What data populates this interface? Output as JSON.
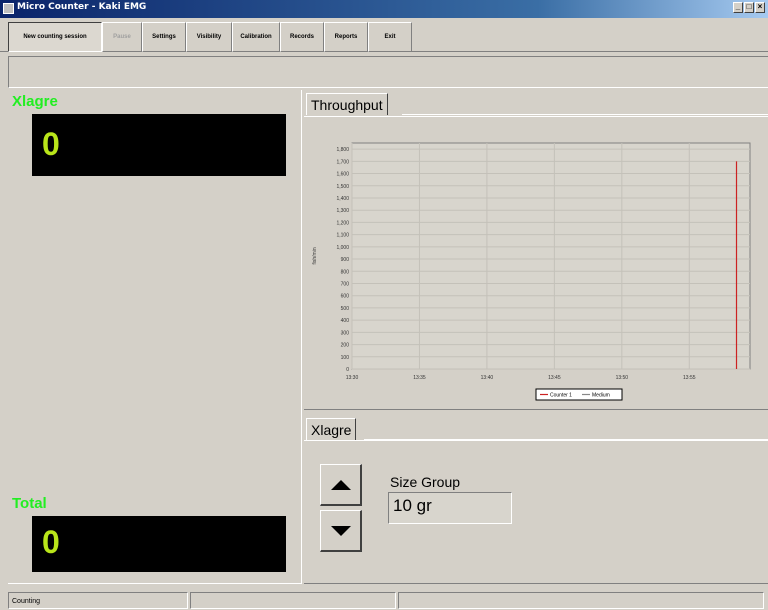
{
  "window": {
    "title": "Micro Counter - Kaki EMG",
    "min_label": "_",
    "max_label": "□",
    "close_label": "×"
  },
  "toolbar": {
    "new_session": "New counting session",
    "pause": "Pause",
    "settings": "Settings",
    "visibility": "Visibility",
    "calibration": "Calibration",
    "records": "Records",
    "reports": "Reports",
    "exit": "Exit"
  },
  "left": {
    "xlagre_label": "Xlagre",
    "xlagre_value": "0",
    "total_label": "Total",
    "total_value": "0"
  },
  "throughput": {
    "tab_label": "Throughput"
  },
  "chart_data": {
    "type": "line",
    "ylabel": "fish/min",
    "xlabel": "",
    "y_ticks": [
      "0",
      "100",
      "200",
      "300",
      "400",
      "500",
      "600",
      "700",
      "800",
      "900",
      "1,000",
      "1,100",
      "1,200",
      "1,300",
      "1,400",
      "1,500",
      "1,600",
      "1,700",
      "1,800"
    ],
    "ylim": [
      0,
      1850
    ],
    "x_ticks": [
      "13:30",
      "13:35",
      "13:40",
      "13:45",
      "13:50",
      "13:55"
    ],
    "series": [
      {
        "name": "Counter 1",
        "color": "#cc2222",
        "points": [
          [
            "13:58.5",
            0
          ],
          [
            "13:58.5",
            1700
          ]
        ]
      },
      {
        "name": "Medium",
        "color": "#888888",
        "points": []
      }
    ],
    "grid": true,
    "legend": "bottom-center"
  },
  "xlagre_panel": {
    "tab_label": "Xlagre",
    "size_group_label": "Size Group",
    "size_group_value": "10 gr"
  },
  "status": {
    "pane1": "Counting",
    "pane2": "",
    "pane3": ""
  }
}
